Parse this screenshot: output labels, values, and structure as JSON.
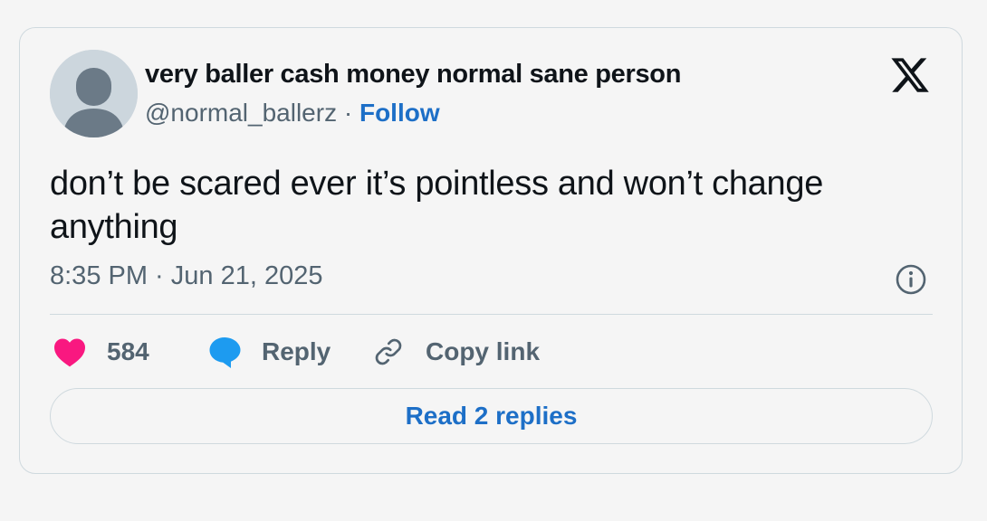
{
  "tweet": {
    "author": {
      "display_name": "very baller cash money normal sane person",
      "handle": "@normal_ballerz",
      "separator": "·",
      "follow_label": "Follow"
    },
    "logo_icon": "x-logo-icon",
    "text": "don’t be scared ever it’s pointless and won’t change anything",
    "timestamp": "8:35 PM · Jun 21, 2025",
    "info_icon": "info-icon",
    "actions": {
      "like": {
        "icon": "heart-icon",
        "count": "584"
      },
      "reply": {
        "icon": "speech-bubble-icon",
        "label": "Reply"
      },
      "copy": {
        "icon": "link-icon",
        "label": "Copy link"
      }
    },
    "read_replies_label": "Read 2 replies"
  },
  "colors": {
    "background": "#f5f5f5",
    "border": "#cfd9de",
    "text_primary": "#0f1419",
    "text_secondary": "#536471",
    "link_blue": "#1d6fc7",
    "heart_pink": "#f91880",
    "reply_blue": "#1d9bf0"
  }
}
